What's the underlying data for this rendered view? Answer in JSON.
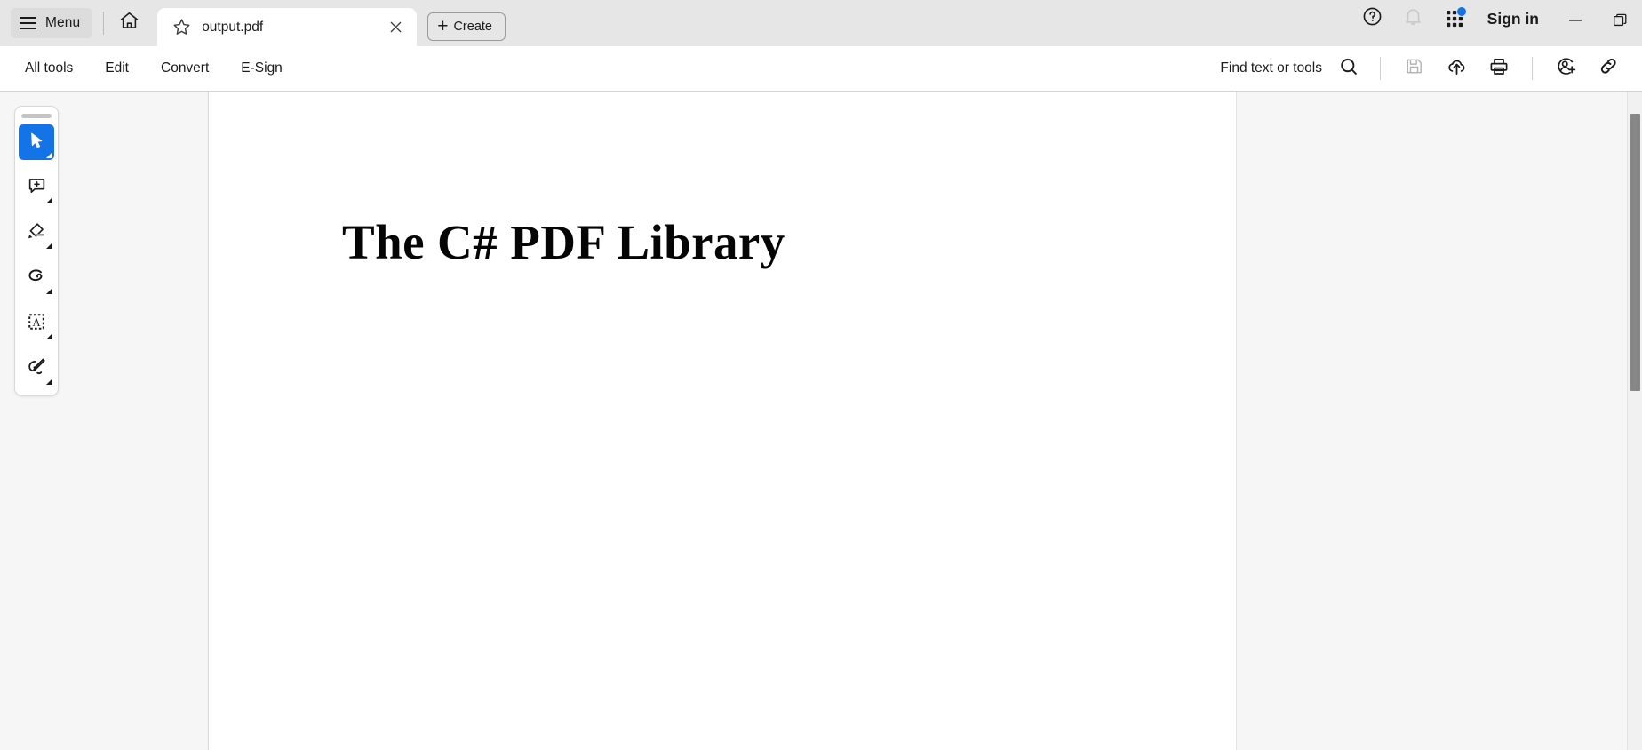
{
  "titlebar": {
    "menu_label": "Menu",
    "menu_icon": "hamburger-icon",
    "home_icon": "home-icon",
    "tab": {
      "star_icon": "star-outline-icon",
      "title": "output.pdf",
      "close_icon": "close-icon"
    },
    "create_label": "Create",
    "create_icon": "plus-icon",
    "help_icon": "help-circle-icon",
    "bell_icon": "bell-icon",
    "apps_icon": "app-grid-icon",
    "signin_label": "Sign in",
    "minimize_icon": "minimize-icon",
    "restore_icon": "restore-window-icon"
  },
  "toolbar": {
    "tabs": [
      {
        "label": "All tools",
        "name": "tab-all-tools"
      },
      {
        "label": "Edit",
        "name": "tab-edit"
      },
      {
        "label": "Convert",
        "name": "tab-convert"
      },
      {
        "label": "E-Sign",
        "name": "tab-e-sign"
      }
    ],
    "find_label": "Find text or tools",
    "find_icon": "search-icon",
    "actions": [
      {
        "name": "save-button",
        "icon": "floppy-save-icon",
        "disabled": true
      },
      {
        "name": "upload-cloud-button",
        "icon": "cloud-upload-icon",
        "disabled": false
      },
      {
        "name": "print-button",
        "icon": "printer-icon",
        "disabled": false
      },
      {
        "name": "share-person-button",
        "icon": "add-person-icon",
        "disabled": false
      },
      {
        "name": "copy-link-button",
        "icon": "link-icon",
        "disabled": false
      }
    ]
  },
  "tools": {
    "grip": "drag-handle",
    "items": [
      {
        "name": "tool-select",
        "icon": "cursor-arrow-icon",
        "label": "Select",
        "active": true
      },
      {
        "name": "tool-add-comment",
        "icon": "comment-plus-icon",
        "label": "Add comment",
        "active": false
      },
      {
        "name": "tool-highlight",
        "icon": "highlighter-icon",
        "label": "Highlight",
        "active": false
      },
      {
        "name": "tool-draw",
        "icon": "draw-freehand-icon",
        "label": "Draw",
        "active": false
      },
      {
        "name": "tool-add-text",
        "icon": "text-box-icon",
        "label": "Add text",
        "active": false
      },
      {
        "name": "tool-sign",
        "icon": "fountain-pen-icon",
        "label": "Sign",
        "active": false
      }
    ]
  },
  "document": {
    "heading": "The C# PDF Library"
  },
  "scrollbar": {
    "thumb_label": "vertical-scroll-thumb"
  },
  "colors": {
    "accent": "#1473e6",
    "titlebar_bg": "#e6e6e6",
    "chrome_bg": "#ffffff",
    "rail_bg": "#f6f6f6",
    "text": "#1b1b1b",
    "notification_dot": "#1473e6"
  }
}
